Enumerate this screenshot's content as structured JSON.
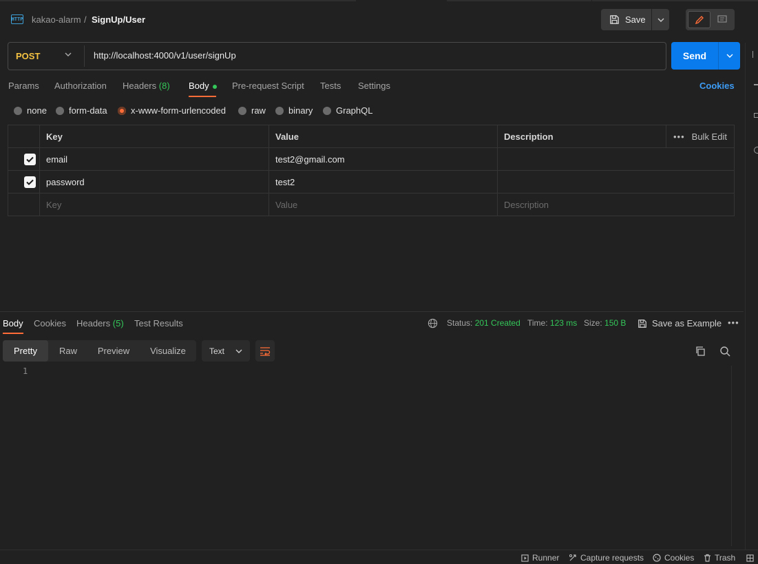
{
  "breadcrumb": {
    "collection": "kakao-alarm",
    "separator": "/",
    "request": "SignUp/User",
    "icon": "http-icon",
    "icon_text": "HTTP"
  },
  "toolbar": {
    "save_label": "Save"
  },
  "request": {
    "method": "POST",
    "url": "http://localhost:4000/v1/user/signUp",
    "send_label": "Send"
  },
  "request_tabs": {
    "params": "Params",
    "authorization": "Authorization",
    "headers": "Headers",
    "headers_count": "(8)",
    "body": "Body",
    "prerequest": "Pre-request Script",
    "tests": "Tests",
    "settings": "Settings",
    "cookies": "Cookies",
    "active": "Body"
  },
  "body_types": {
    "none": "none",
    "form_data": "form-data",
    "urlencoded": "x-www-form-urlencoded",
    "raw": "raw",
    "binary": "binary",
    "graphql": "GraphQL",
    "selected": "x-www-form-urlencoded"
  },
  "kv_table": {
    "headers": {
      "key": "Key",
      "value": "Value",
      "description": "Description",
      "bulk_edit": "Bulk Edit"
    },
    "rows": [
      {
        "checked": true,
        "key": "email",
        "value": "test2@gmail.com",
        "description": ""
      },
      {
        "checked": true,
        "key": "password",
        "value": "test2",
        "description": ""
      }
    ],
    "placeholder": {
      "key": "Key",
      "value": "Value",
      "description": "Description"
    }
  },
  "response": {
    "tabs": {
      "body": "Body",
      "cookies": "Cookies",
      "headers": "Headers",
      "headers_count": "(5)",
      "test_results": "Test Results"
    },
    "status_label": "Status:",
    "status_value": "201 Created",
    "time_label": "Time:",
    "time_value": "123 ms",
    "size_label": "Size:",
    "size_value": "150 B",
    "save_example": "Save as Example",
    "views": {
      "pretty": "Pretty",
      "raw": "Raw",
      "preview": "Preview",
      "visualize": "Visualize"
    },
    "format": "Text",
    "line_number": "1"
  },
  "footer": {
    "runner": "Runner",
    "capture": "Capture requests",
    "cookies": "Cookies",
    "trash": "Trash"
  },
  "colors": {
    "accent": "#ff6c37",
    "send": "#097bed",
    "method": "#f5c242",
    "success": "#34c759",
    "link": "#3d9cf5"
  }
}
